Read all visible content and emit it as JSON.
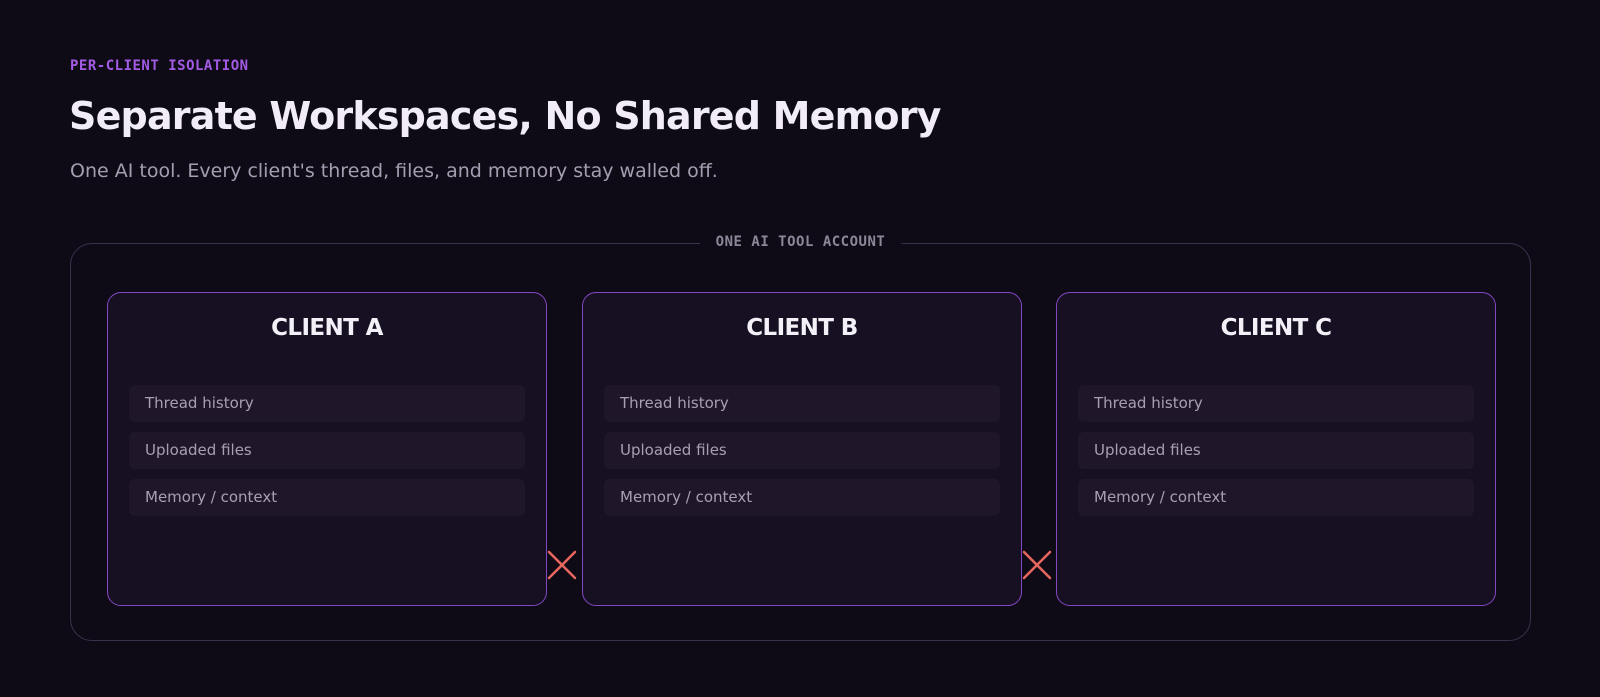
{
  "header": {
    "eyebrow": "PER-CLIENT ISOLATION",
    "title": "Separate Workspaces, No Shared Memory",
    "subtitle": "One AI tool. Every client's thread, files, and memory stay walled off."
  },
  "account": {
    "label": "ONE AI TOOL ACCOUNT"
  },
  "clients": [
    {
      "name": "CLIENT A",
      "items": [
        "Thread history",
        "Uploaded files",
        "Memory / context"
      ]
    },
    {
      "name": "CLIENT B",
      "items": [
        "Thread history",
        "Uploaded files",
        "Memory / context"
      ]
    },
    {
      "name": "CLIENT C",
      "items": [
        "Thread history",
        "Uploaded files",
        "Memory / context"
      ]
    }
  ],
  "colors": {
    "background": "#0f0b16",
    "accent": "#a35be6",
    "client_border": "#8247c2",
    "separator": "#e8675f"
  },
  "icons": {
    "separator": "cross-icon"
  }
}
